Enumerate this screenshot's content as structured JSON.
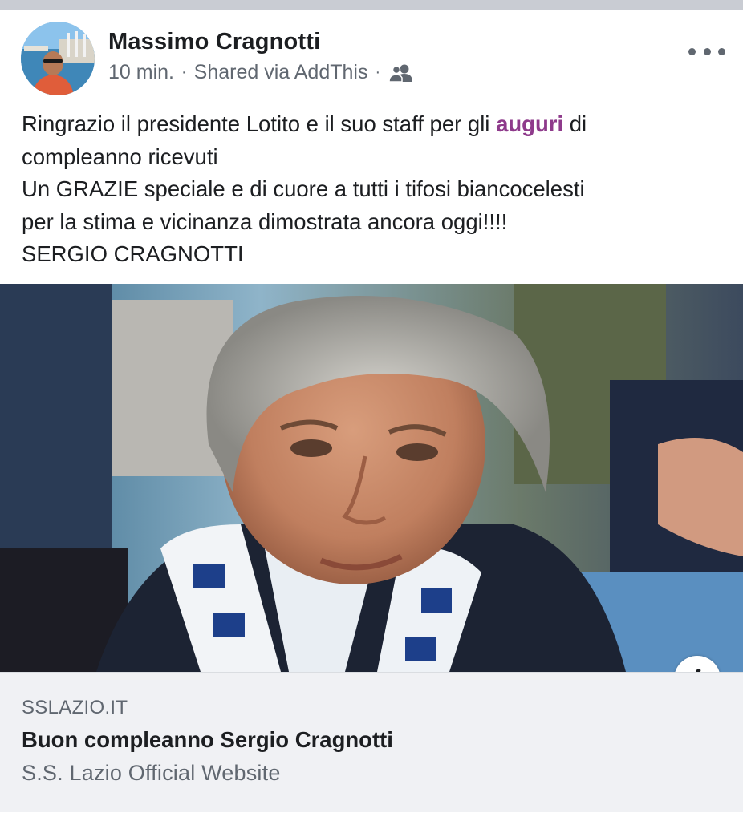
{
  "post": {
    "author": "Massimo Cragnotti",
    "time": "10 min.",
    "separator": "·",
    "shared_via": "Shared via AddThis",
    "audience_icon": "friends-icon",
    "more_icon": "more-options-icon",
    "text": {
      "line1_before": "Ringrazio il presidente Lotito e il suo staff per gli ",
      "line1_hashtag": "auguri",
      "line1_after": " di",
      "line2": "compleanno ricevuti",
      "line3": "Un GRAZIE speciale e di cuore a tutti i tifosi biancocelesti",
      "line4": "per la stima e vicinanza dimostrata ancora oggi!!!!",
      "line5": "SERGIO CRAGNOTTI"
    }
  },
  "link_preview": {
    "image_icon": "link-photo",
    "info_icon": "info-icon",
    "info_glyph": "i",
    "domain": "SSLAZIO.IT",
    "title": "Buon compleanno Sergio Cragnotti",
    "description": "S.S. Lazio Official Website"
  },
  "colors": {
    "hashtag": "#8e3a8b",
    "secondary_text": "#606770",
    "link_box_bg": "#f0f1f4"
  }
}
